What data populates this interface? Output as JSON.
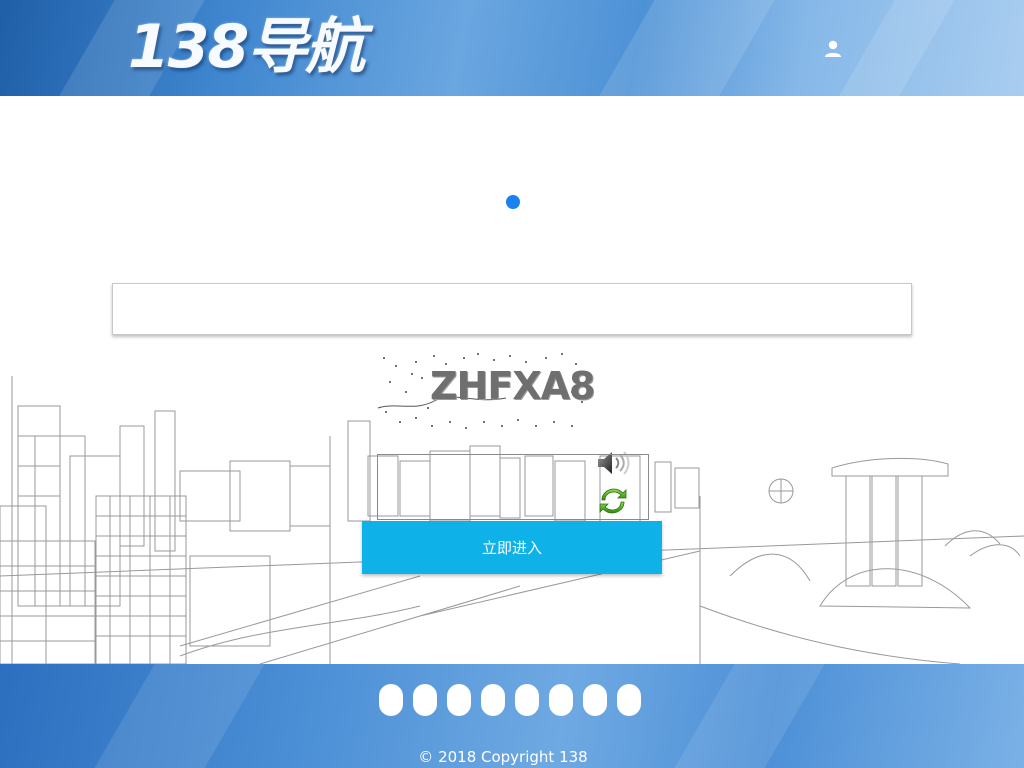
{
  "header": {
    "logo_text": "138导航",
    "user_icon": "user-icon"
  },
  "main": {
    "loader_icon": "loading-dot-icon",
    "search": {
      "value": "",
      "placeholder": ""
    },
    "captcha": {
      "text": "ZHFXA8",
      "audio_icon": "speaker-icon",
      "refresh_icon": "refresh-icon"
    },
    "code_input": {
      "value": "",
      "placeholder": ""
    },
    "submit_label": "立即进入",
    "accent_color": "#0fb2e8"
  },
  "footer": {
    "link_count": 8,
    "copyright": "© 2018 Copyright 138"
  }
}
